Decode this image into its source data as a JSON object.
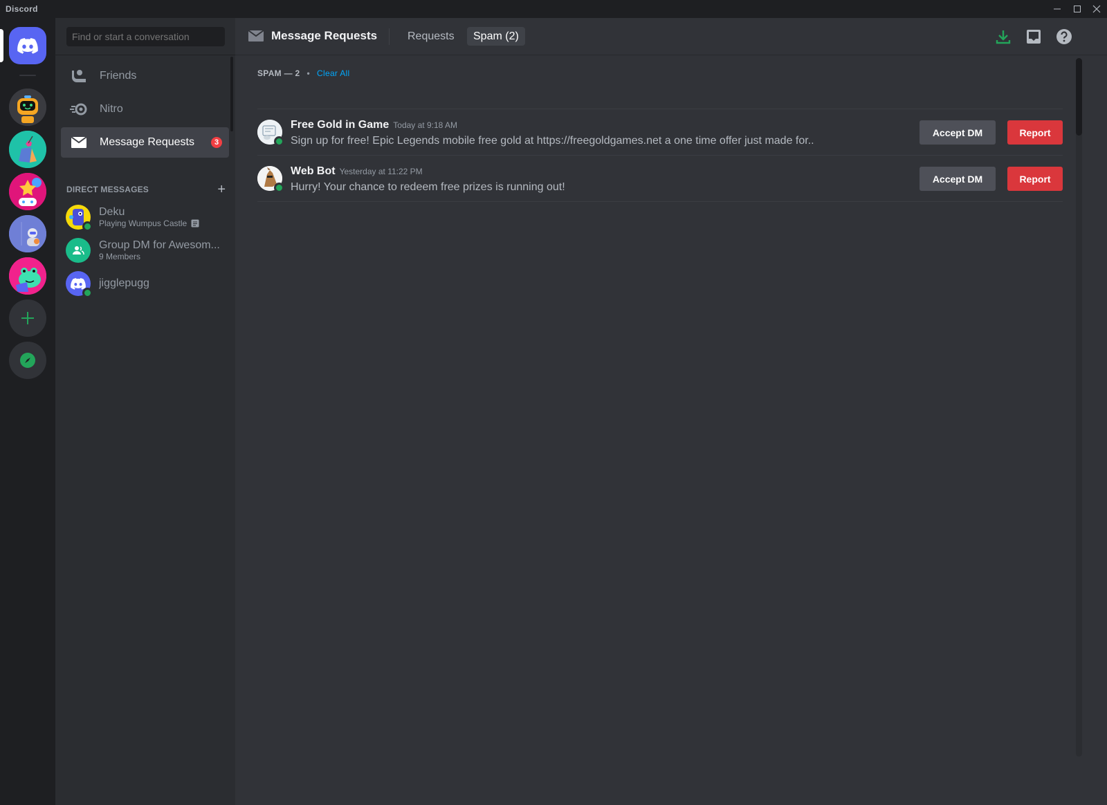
{
  "window": {
    "app_name": "Discord",
    "controls": {
      "minimize": "—",
      "maximize": "☐",
      "close": "✕"
    }
  },
  "guilds": {
    "home_icon": "discord-logo-icon",
    "servers": [
      {
        "name": "robot-server",
        "icon": "robot-avatar"
      },
      {
        "name": "teal-server",
        "icon": "shopping-bag-avatar"
      },
      {
        "name": "pink-server",
        "icon": "gamer-avatar"
      },
      {
        "name": "space-server",
        "icon": "astronaut-avatar"
      },
      {
        "name": "frog-server",
        "icon": "frog-avatar"
      }
    ],
    "add_server_glyph": "+",
    "explore_icon": "compass-icon"
  },
  "sidebar": {
    "search_placeholder": "Find or start a conversation",
    "nav": [
      {
        "label": "Friends",
        "icon": "friends-icon"
      },
      {
        "label": "Nitro",
        "icon": "nitro-icon"
      },
      {
        "label": "Message Requests",
        "icon": "mail-icon",
        "badge": "3",
        "active": true
      }
    ],
    "dm_header": "DIRECT MESSAGES",
    "dm_add_glyph": "+",
    "dms": [
      {
        "name": "Deku",
        "sub": "Playing Wumpus Castle",
        "status": "online"
      },
      {
        "name": "Group DM for Awesom...",
        "sub": "9 Members"
      },
      {
        "name": "jigglepugg",
        "status": "online"
      }
    ]
  },
  "header": {
    "title": "Message Requests",
    "tabs": [
      {
        "label": "Requests",
        "selected": false
      },
      {
        "label": "Spam (2)",
        "selected": true
      }
    ],
    "icons": [
      "download-icon",
      "inbox-icon",
      "help-icon"
    ]
  },
  "content": {
    "section_label": "SPAM — 2",
    "separator": "•",
    "clear_all": "Clear All",
    "requests": [
      {
        "name": "Free Gold in Game",
        "time": "Today at 9:18 AM",
        "message": "Sign up for free! Epic Legends mobile free gold at https://freegoldgames.net a one time offer just made for..",
        "accept_label": "Accept DM",
        "report_label": "Report"
      },
      {
        "name": "Web Bot",
        "time": "Yesterday at 11:22 PM",
        "message": "Hurry! Your chance to redeem free prizes is running out!",
        "accept_label": "Accept DM",
        "report_label": "Report"
      }
    ]
  },
  "colors": {
    "brand": "#5865f2",
    "online": "#23a55a",
    "danger": "#da373c",
    "link": "#00a8fc",
    "badge": "#f23f43"
  }
}
